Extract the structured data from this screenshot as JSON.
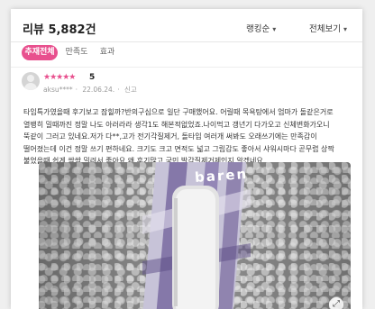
{
  "header": {
    "review_count": "리뷰 5,882건",
    "sort_label": "랭킹순",
    "view_label": "전체보기"
  },
  "tabs": [
    {
      "label": "추재전체",
      "active": true
    },
    {
      "label": "만족도",
      "active": false
    },
    {
      "label": "효과",
      "active": false
    }
  ],
  "review": {
    "stars": "★★★★★",
    "rating": "5",
    "author": "aksu****",
    "date": "22.06.24.",
    "report_label": "신고",
    "text": "타임특가였을때 후기보고 잠힐까?반의구심으로 일단 구매했어요. 어릴때 목욕탕에서 엄마가 돌같은거로 열뱅히 밀때까진 정말 나도 아러라라 생각1도 해본적없었죠.나이먹고 갱년기 다가오고 신체변화가오니 뚝같이 그러고 있네요.저가 다**,고가 전기각질제거, 돌타입 여러개 써봐도 오래쓰기에는 만족감이 떨어졌는데 이건 정말 쓰기 편하네요. 크기도 크고 면적도 넓고 그립감도 좋아서 샤워시마다 곧무렵 상짝 불었을때 쉽게 싹싹 밀려서 좋아요.왜 후기많고 국민 발각질제거제인지 알겠네요."
  },
  "photo": {
    "brand_text": "baren"
  },
  "icons": {
    "expand": "expand-icon",
    "avatar": "user-avatar-icon",
    "chevron": "chevron-down-icon"
  },
  "colors": {
    "accent": "#e8508e"
  }
}
